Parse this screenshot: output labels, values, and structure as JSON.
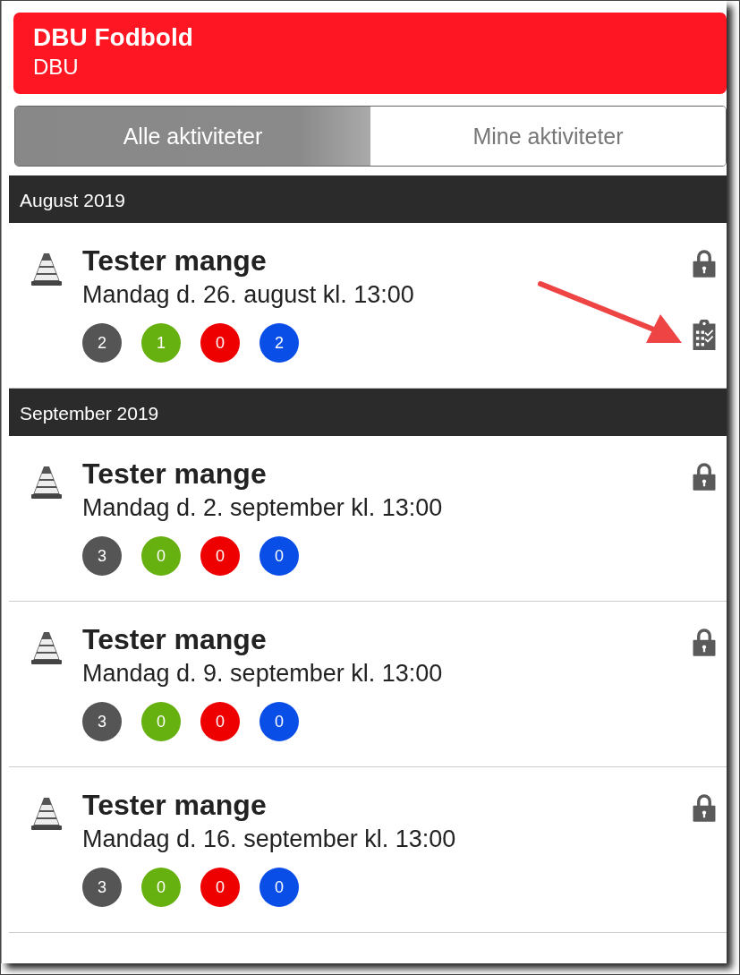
{
  "header": {
    "title": "DBU Fodbold",
    "subtitle": "DBU"
  },
  "tabs": [
    {
      "label": "Alle aktiviteter",
      "selected": true
    },
    {
      "label": "Mine aktiviteter",
      "selected": false
    }
  ],
  "sections": [
    {
      "month": "August 2019",
      "activities": [
        {
          "title": "Tester mange",
          "when": "Mandag d. 26. august kl. 13:00",
          "locked": true,
          "checklist": true,
          "counts": [
            {
              "value": "2",
              "color": "#555555"
            },
            {
              "value": "1",
              "color": "#66b010"
            },
            {
              "value": "0",
              "color": "#ee0000"
            },
            {
              "value": "2",
              "color": "#0a4ee8"
            }
          ]
        }
      ]
    },
    {
      "month": "September 2019",
      "activities": [
        {
          "title": "Tester mange",
          "when": "Mandag d. 2. september kl. 13:00",
          "locked": true,
          "checklist": false,
          "counts": [
            {
              "value": "3",
              "color": "#555555"
            },
            {
              "value": "0",
              "color": "#66b010"
            },
            {
              "value": "0",
              "color": "#ee0000"
            },
            {
              "value": "0",
              "color": "#0a4ee8"
            }
          ]
        },
        {
          "title": "Tester mange",
          "when": "Mandag d. 9. september kl. 13:00",
          "locked": true,
          "checklist": false,
          "counts": [
            {
              "value": "3",
              "color": "#555555"
            },
            {
              "value": "0",
              "color": "#66b010"
            },
            {
              "value": "0",
              "color": "#ee0000"
            },
            {
              "value": "0",
              "color": "#0a4ee8"
            }
          ]
        },
        {
          "title": "Tester mange",
          "when": "Mandag d. 16. september kl. 13:00",
          "locked": true,
          "checklist": false,
          "counts": [
            {
              "value": "3",
              "color": "#555555"
            },
            {
              "value": "0",
              "color": "#66b010"
            },
            {
              "value": "0",
              "color": "#ee0000"
            },
            {
              "value": "0",
              "color": "#0a4ee8"
            }
          ]
        }
      ]
    }
  ]
}
